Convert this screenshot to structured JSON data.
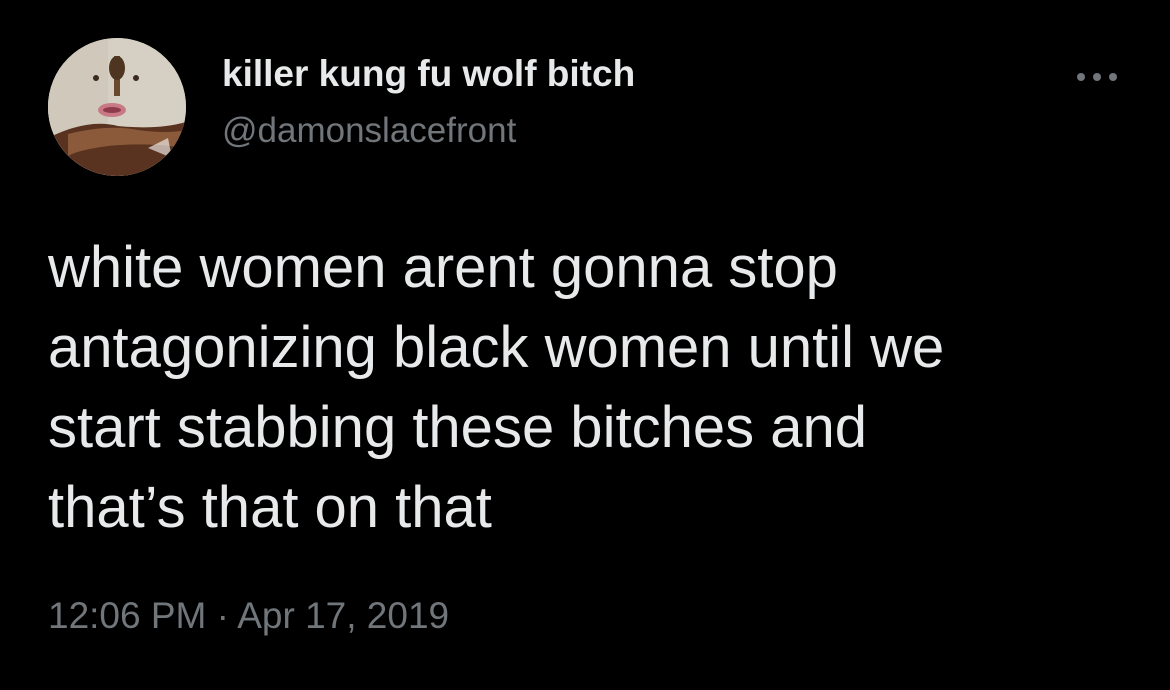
{
  "tweet": {
    "author": {
      "display_name": "killer kung fu wolf bitch",
      "handle": "@damonslacefront",
      "avatar": "profile-photo"
    },
    "text": "white women arent gonna stop\nantagonizing black women until we\nstart stabbing these bitches and\nthat’s that on that",
    "time": "12:06 PM",
    "separator": "·",
    "date": "Apr 17, 2019",
    "more_icon": "more-horizontal-icon"
  },
  "colors": {
    "background": "#000000",
    "primary_text": "#e7e9ea",
    "secondary_text": "#71767b"
  }
}
